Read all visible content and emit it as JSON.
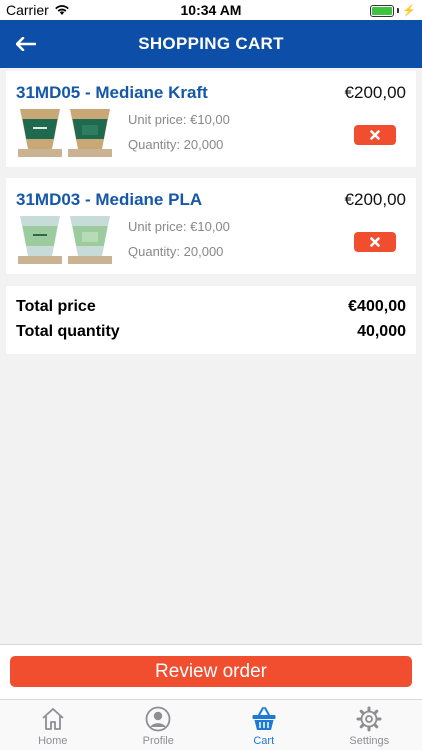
{
  "status_bar": {
    "carrier": "Carrier",
    "time": "10:34 AM"
  },
  "header": {
    "title": "SHOPPING CART"
  },
  "cart_items": [
    {
      "title": "31MD05 - Mediane Kraft",
      "price": "€200,00",
      "unit_price": "Unit price: €10,00",
      "quantity": "Quantity: 20,000"
    },
    {
      "title": "31MD03 - Mediane PLA",
      "price": "€200,00",
      "unit_price": "Unit price: €10,00",
      "quantity": "Quantity: 20,000"
    }
  ],
  "summary": {
    "total_price_label": "Total price",
    "total_price": "€400,00",
    "total_quantity_label": "Total quantity",
    "total_quantity": "40,000"
  },
  "review_button": {
    "label": "Review order"
  },
  "tabs": [
    {
      "label": "Home",
      "icon": "home-icon"
    },
    {
      "label": "Profile",
      "icon": "profile-icon"
    },
    {
      "label": "Cart",
      "icon": "basket-icon"
    },
    {
      "label": "Settings",
      "icon": "gear-icon"
    }
  ],
  "colors": {
    "nav": "#0d4fa8",
    "accent": "#f04e2f",
    "title": "#1558a8",
    "active_tab": "#1a7ad6"
  }
}
